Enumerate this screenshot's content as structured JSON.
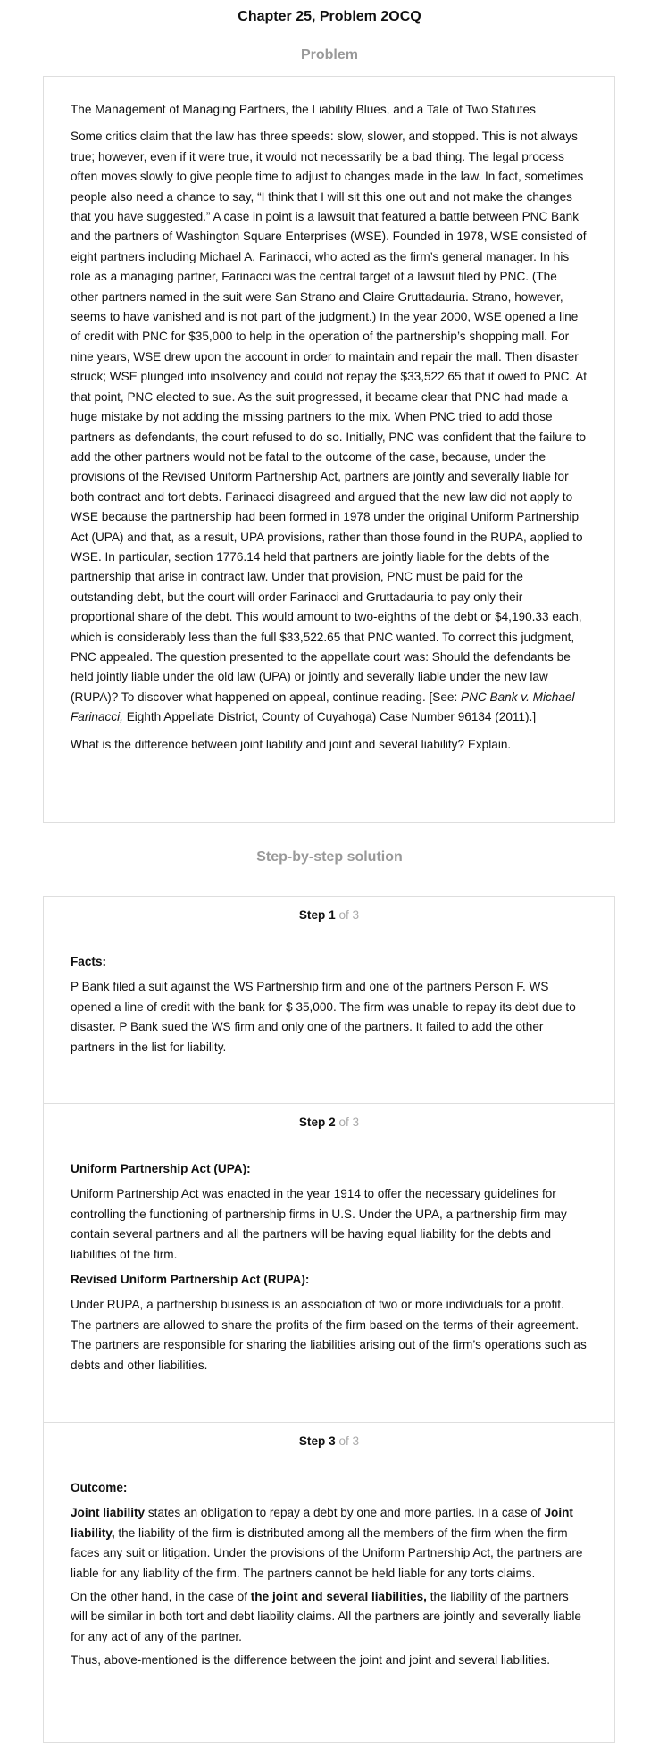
{
  "header": {
    "title": "Chapter 25, Problem 2OCQ",
    "problem_heading": "Problem",
    "solution_heading": "Step-by-step solution"
  },
  "problem": {
    "title": "The Management of Managing Partners, the Liability Blues, and a Tale of Two Statutes",
    "body_main": "Some critics claim that the law has three speeds: slow, slower, and stopped. This is not always true; however, even if it were true, it would not necessarily be a bad thing. The legal process often moves slowly to give people time to adjust to changes made in the law. In fact, sometimes people also need a chance to say, “I think that I will sit this one out and not make the changes that you have suggested.” A case in point is a lawsuit that featured a battle between PNC Bank and the partners of Washington Square Enterprises (WSE). Founded in 1978, WSE consisted of eight partners including Michael A. Farinacci, who acted as the firm’s general manager. In his role as a managing partner, Farinacci was the central target of a lawsuit filed by PNC. (The other partners named in the suit were San Strano and Claire Gruttadauria. Strano, however, seems to have vanished and is not part of the judgment.) In the year 2000, WSE opened a line of credit with PNC for $35,000 to help in the operation of the partnership’s shopping mall. For nine years, WSE drew upon the account in order to maintain and repair the mall. Then disaster struck; WSE plunged into insolvency and could not repay the $33,522.65 that it owed to PNC. At that point, PNC elected to sue. As the suit progressed, it became clear that PNC had made a huge mistake by not adding the missing partners to the mix. When PNC tried to add those partners as defendants, the court refused to do so. Initially, PNC was confident that the failure to add the other partners would not be fatal to the outcome of the case, because, under the provisions of the Revised Uniform Partnership Act, partners are jointly and severally liable for both contract and tort debts. Farinacci disagreed and argued that the new law did not apply to WSE because the partnership had been formed in 1978 under the original Uniform Partnership Act (UPA) and that, as a result, UPA provisions, rather than those found in the RUPA, applied to WSE. In particular, section 1776.14 held that partners are jointly liable for the debts of the partnership that arise in contract law. Under that provision, PNC must be paid for the outstanding debt, but the court will order Farinacci and Gruttadauria to pay only their proportional share of the debt. This would amount to two-eighths of the debt or $4,190.33 each, which is considerably less than the full $33,522.65 that PNC wanted. To correct this judgment, PNC appealed. The question presented to the appellate court was: Should the defendants be held jointly liable under the old law (UPA) or jointly and severally liable under the new law (RUPA)? To discover what happened on appeal, continue reading. [See: ",
    "case_name": "PNC Bank v. Michael Farinacci,",
    "citation_tail": " Eighth Appellate District, County of Cuyahoga) Case Number 96134 (2011).]",
    "question": "What is the difference between joint liability and joint and several liability? Explain."
  },
  "steps": [
    {
      "label": "Step 1",
      "of": "of 3",
      "heading": "Facts:",
      "text": "P Bank filed a suit against the WS Partnership firm and one of the partners Person F. WS opened a line of credit with the bank for $ 35,000. The firm was unable to repay its debt due to disaster. P Bank sued the WS firm and only one of the partners. It failed to add the other partners in the list for liability."
    },
    {
      "label": "Step 2",
      "of": "of 3",
      "heading_a": "Uniform Partnership Act (UPA):",
      "text_a": "Uniform Partnership Act was enacted in the year 1914 to offer the necessary guidelines for controlling the functioning of partnership firms in U.S. Under the UPA, a partnership firm may contain several partners and all the partners will be having equal liability for the debts and liabilities of the firm.",
      "heading_b": "Revised Uniform Partnership Act (RUPA):",
      "text_b": "Under RUPA, a partnership business is an association of two or more individuals for a profit. The partners are allowed to share the profits of the firm based on the terms of their agreement. The partners are responsible for sharing the liabilities arising out of the firm’s operations such as debts and other liabilities."
    },
    {
      "label": "Step 3",
      "of": "of 3",
      "heading": "Outcome:",
      "p1_bold1": "Joint liability",
      "p1_text1": " states an obligation to repay a debt by one and more parties. In a case of ",
      "p1_bold2": "Joint liability,",
      "p1_text2": " the liability of the firm is distributed among all the members of the firm when the firm faces any suit or litigation. Under the provisions of the Uniform Partnership Act, the partners are liable for any liability of the firm. The partners cannot be held liable for any torts claims.",
      "p2_text1": "On the other hand, in the case of ",
      "p2_bold": "the joint and several liabilities,",
      "p2_text2": " the liability of the partners will be similar in both tort and debt liability claims. All the partners are jointly and severally liable for any act of any of the partner.",
      "p3": "Thus, above-mentioned is the difference between the joint and joint and several liabilities."
    }
  ]
}
